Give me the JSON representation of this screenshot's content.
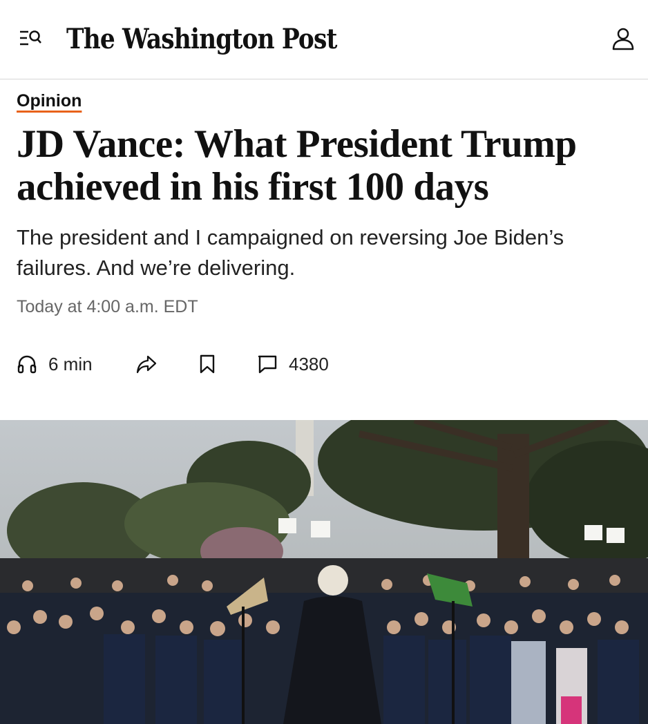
{
  "header": {
    "masthead": "The Washington Post",
    "menu_icon": "menu-search-icon",
    "account_icon": "user-icon"
  },
  "article": {
    "section": "Opinion",
    "headline": "JD Vance: What President Trump achieved in his first 100 days",
    "subhead": "The president and I campaigned on reversing Joe Biden’s failures. And we’re delivering.",
    "timestamp": "Today at 4:00 a.m. EDT"
  },
  "actions": {
    "listen_icon": "headphones-icon",
    "listen_label": "6 min",
    "share_icon": "share-icon",
    "save_icon": "bookmark-icon",
    "comments_icon": "comment-icon",
    "comments_count": "4380"
  },
  "colors": {
    "accent_underline": "#e8621a",
    "text": "#111111",
    "muted": "#666666"
  }
}
